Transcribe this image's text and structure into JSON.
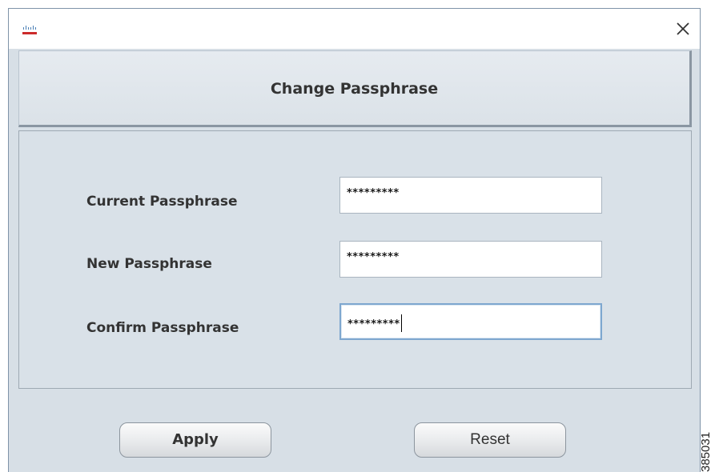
{
  "window": {
    "logo_icon": "cisco-logo-icon",
    "close_icon": "close-icon"
  },
  "header": {
    "title": "Change Passphrase"
  },
  "form": {
    "current": {
      "label": "Current Passphrase",
      "value": "*********"
    },
    "new": {
      "label": "New Passphrase",
      "value": "*********"
    },
    "confirm": {
      "label": "Confirm Passphrase",
      "value": "*********",
      "focused": true
    }
  },
  "buttons": {
    "apply_label": "Apply",
    "reset_label": "Reset"
  },
  "figure_id": "385031",
  "colors": {
    "window_bg": "#d7dfe6",
    "focus_border": "#7ea7cf",
    "logo_red": "#cc2b2b",
    "logo_blue": "#4a7fb5"
  }
}
